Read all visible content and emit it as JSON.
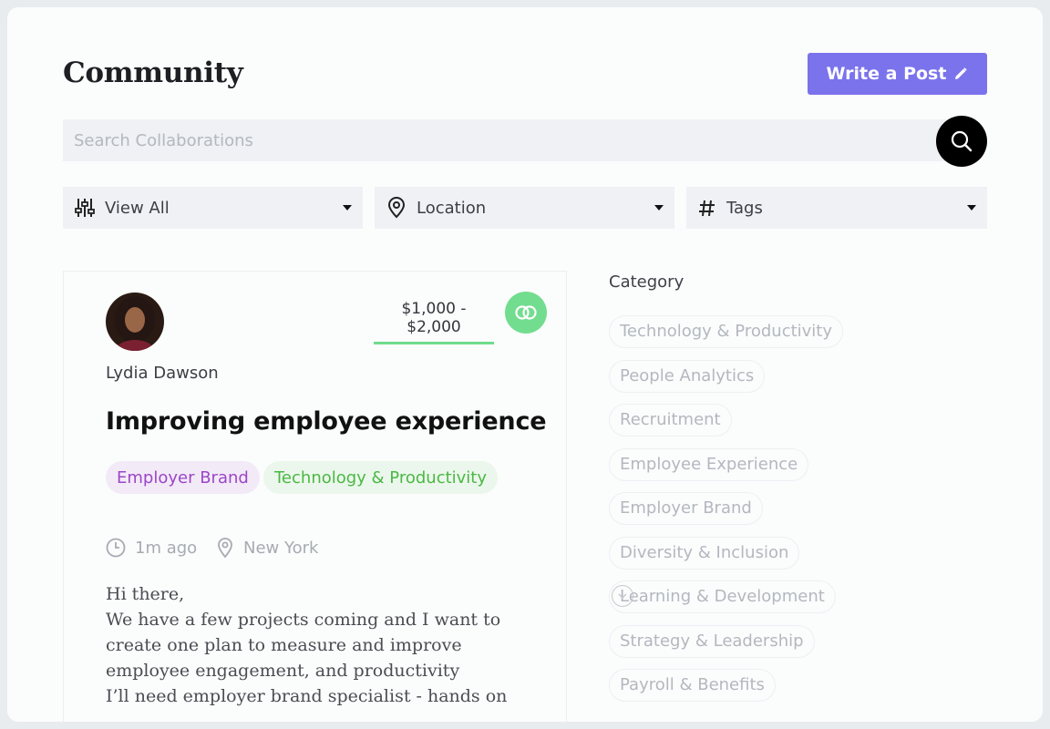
{
  "header": {
    "title": "Community",
    "write_post_label": "Write a Post"
  },
  "search": {
    "placeholder": "Search Collaborations"
  },
  "filters": {
    "view_all": "View All",
    "location": "Location",
    "tags": "Tags"
  },
  "post": {
    "author": "Lydia Dawson",
    "budget": "$1,000 - $2,000",
    "title": "Improving employee experience",
    "tags": [
      "Employer Brand",
      "Technology & Productivity"
    ],
    "time_ago": "1m ago",
    "location": "New York",
    "body": "Hi there,\nWe have a few projects coming and I want to create one plan to measure and improve employee engagement, and productivity\nI’ll need employer brand specialist - hands on"
  },
  "categories": {
    "heading": "Category",
    "items": [
      "Technology & Productivity",
      "People Analytics",
      "Recruitment",
      "Employee Experience",
      "Employer Brand",
      "Diversity & Inclusion",
      "Learning & Development",
      "Strategy & Leadership",
      "Payroll & Benefits"
    ]
  },
  "colors": {
    "accent": "#7b73ec",
    "budget_underline": "#6fdc8c",
    "collab_icon_bg": "#72dd8f",
    "tag_purple": "#9b46c7",
    "tag_green": "#4bb843"
  }
}
